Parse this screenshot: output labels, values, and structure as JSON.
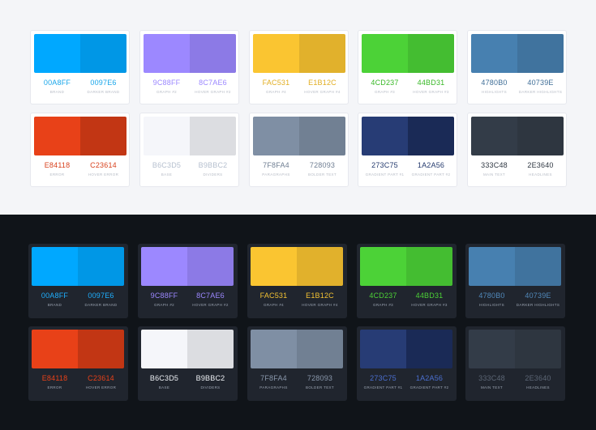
{
  "palette": [
    {
      "base": {
        "hex": "00A8FF",
        "name": "BRAND",
        "color": "#00A8FF"
      },
      "hover": {
        "hex": "0097E6",
        "name": "DARKER BRAND",
        "color": "#0097E6"
      },
      "light_text": "#19a6ea",
      "dark_text": "#1fb0ff"
    },
    {
      "base": {
        "hex": "9C88FF",
        "name": "GRAPH #2",
        "color": "#9C88FF"
      },
      "hover": {
        "hex": "8C7AE6",
        "name": "HOVER GRAPH #2",
        "color": "#8C7AE6"
      },
      "light_text": "#9c88ff",
      "dark_text": "#9c88ff"
    },
    {
      "base": {
        "hex": "FAC531",
        "name": "GRAPH #4",
        "color": "#FAC531"
      },
      "hover": {
        "hex": "E1B12C",
        "name": "HOVER GRAPH #4",
        "color": "#E1B12C"
      },
      "light_text": "#e2ae22",
      "dark_text": "#f3c233"
    },
    {
      "base": {
        "hex": "4CD237",
        "name": "GRAPH #3",
        "color": "#4CD237"
      },
      "hover": {
        "hex": "44BD31",
        "name": "HOVER GRAPH #3",
        "color": "#44BD31"
      },
      "light_text": "#38b826",
      "dark_text": "#4cd237"
    },
    {
      "base": {
        "hex": "4780B0",
        "name": "HIGHLIGHTS",
        "color": "#4780B0"
      },
      "hover": {
        "hex": "40739E",
        "name": "DARKER HIGHLIGHTS",
        "color": "#40739E"
      },
      "light_text": "#3f6e97",
      "dark_text": "#5189bb"
    },
    {
      "base": {
        "hex": "E84118",
        "name": "ERROR",
        "color": "#E84118"
      },
      "hover": {
        "hex": "C23614",
        "name": "HOVER ERROR",
        "color": "#C23614"
      },
      "light_text": "#d8421e",
      "dark_text": "#e84118"
    },
    {
      "base": {
        "hex": "B6C3D5",
        "name": "BASE",
        "color": "#F5F6FA"
      },
      "hover": {
        "hex": "B9BBC2",
        "name": "DIVIDERS",
        "color": "#DCDDE1"
      },
      "light_text": "#b6c0cf",
      "dark_text": "#eef1f5"
    },
    {
      "base": {
        "hex": "7F8FA4",
        "name": "PARAGRAPHS",
        "color": "#7F8FA4"
      },
      "hover": {
        "hex": "728093",
        "name": "BOLDER TEXT",
        "color": "#718093"
      },
      "light_text": "#6f7e92",
      "dark_text": "#8a98ac"
    },
    {
      "base": {
        "hex": "273C75",
        "name": "GRADIENT PART #1",
        "color": "#273C75"
      },
      "hover": {
        "hex": "1A2A56",
        "name": "GRADIENT PART #2",
        "color": "#1A2A56"
      },
      "light_text": "#243a6e",
      "dark_text": "#4b6fd0"
    },
    {
      "base": {
        "hex": "333C48",
        "name": "MAIN TEXT",
        "color": "#333C48"
      },
      "hover": {
        "hex": "2E3640",
        "name": "HEADLINES",
        "color": "#2E3640"
      },
      "light_text": "#2f3742",
      "dark_text": "#5c6675"
    }
  ]
}
